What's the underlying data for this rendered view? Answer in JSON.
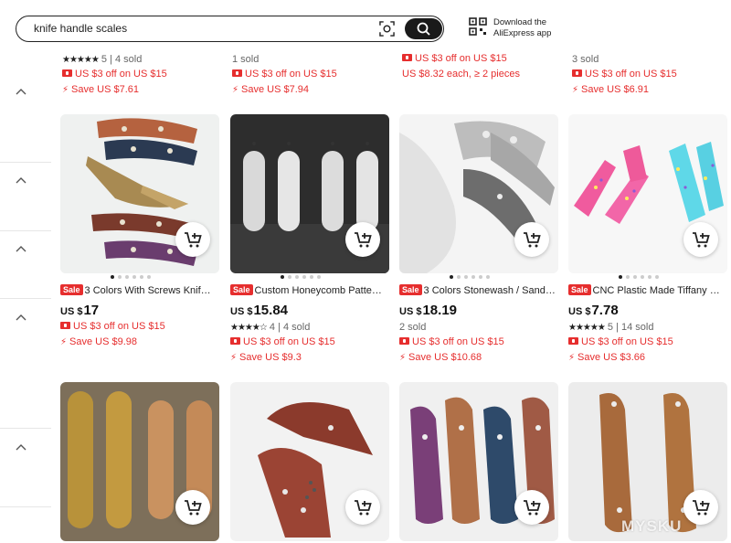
{
  "search": {
    "query": "knife handle scales"
  },
  "app_download": {
    "line1": "Download the",
    "line2": "AliExpress app"
  },
  "top_row": [
    {
      "rating_count": "5",
      "sold": "4 sold",
      "promo": "US $3 off on US $15",
      "save": "Save US $7.61"
    },
    {
      "sold": "1 sold",
      "promo": "US $3 off on US $15",
      "save": "Save US $7.94"
    },
    {
      "promo": "US $3 off on US $15",
      "extra": "US $8.32 each, ≥ 2 pieces"
    },
    {
      "sold": "3 sold",
      "promo": "US $3 off on US $15",
      "save": "Save US $6.91"
    }
  ],
  "products": [
    {
      "sale": "Sale",
      "title": "3 Colors With Screws Knif…",
      "currency": "US $",
      "price": "17",
      "promo": "US $3 off on US $15",
      "save": "Save US $9.98"
    },
    {
      "sale": "Sale",
      "title": "Custom Honeycomb Patte…",
      "currency": "US $",
      "price": "15.84",
      "rating_count": "4",
      "sold": "4 sold",
      "promo": "US $3 off on US $15",
      "save": "Save US $9.3"
    },
    {
      "sale": "Sale",
      "title": "3 Colors Stonewash / Sand…",
      "currency": "US $",
      "price": "18.19",
      "sold": "2 sold",
      "promo": "US $3 off on US $15",
      "save": "Save US $10.68"
    },
    {
      "sale": "Sale",
      "title": "CNC Plastic Made Tiffany …",
      "currency": "US $",
      "price": "7.78",
      "rating_count": "5",
      "sold": "14 sold",
      "promo": "US $3 off on US $15",
      "save": "Save US $3.66"
    }
  ],
  "separator": "|",
  "watermark": "MYSKU",
  "colors": {
    "accent_red": "#e62e2e",
    "text": "#222222",
    "search_button": "#1a1a1a"
  }
}
